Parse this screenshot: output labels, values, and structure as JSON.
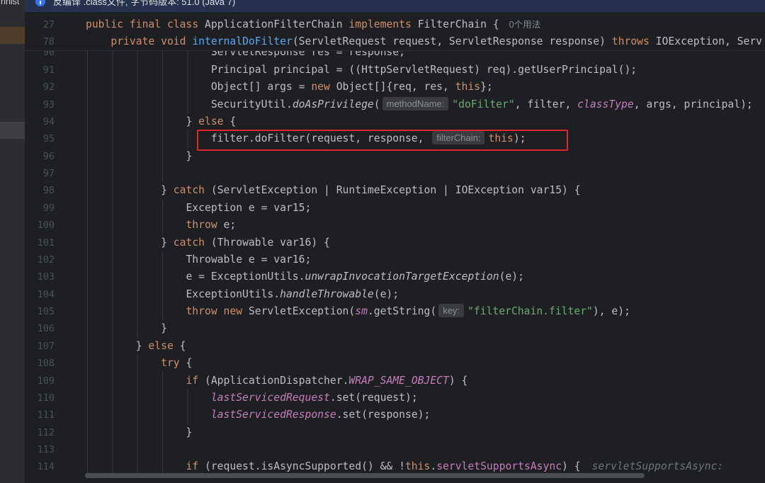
{
  "window": {
    "sidebar_label": "nnist"
  },
  "banner": {
    "icon": "info-icon",
    "text": "反编译 .class文件, 字节码版本: 51.0 (Java 7)"
  },
  "colors": {
    "editor_bg": "#1e1f22",
    "banner": "#25324d",
    "keyword": "#cf8e6d",
    "plain_text": "#bcbec4",
    "method_declaration": "#56a8f5",
    "string": "#6aab73",
    "field": "#c77dbb",
    "line_number": "#4b5059",
    "hint_bg": "#393b40",
    "hint_text": "#8c8f94",
    "highlight_box": "#e0262a"
  },
  "sticky_lines": [
    {
      "number": "27",
      "depth": 0,
      "usages": "0个用法",
      "tokens": [
        {
          "k": "kw",
          "s": "public"
        },
        {
          "k": "plain",
          "s": " "
        },
        {
          "k": "kw",
          "s": "final"
        },
        {
          "k": "plain",
          "s": " "
        },
        {
          "k": "kw",
          "s": "class"
        },
        {
          "k": "plain",
          "s": " ApplicationFilterChain "
        },
        {
          "k": "kw",
          "s": "implements"
        },
        {
          "k": "plain",
          "s": " FilterChain {"
        }
      ]
    },
    {
      "number": "78",
      "depth": 1,
      "tokens": [
        {
          "k": "kw",
          "s": "private"
        },
        {
          "k": "plain",
          "s": " "
        },
        {
          "k": "kw",
          "s": "void"
        },
        {
          "k": "plain",
          "s": " "
        },
        {
          "k": "decl",
          "s": "internalDoFilter"
        },
        {
          "k": "plain",
          "s": "(ServletRequest request, ServletResponse response) "
        },
        {
          "k": "kw",
          "s": "throws"
        },
        {
          "k": "plain",
          "s": " IOException, Serv"
        }
      ]
    }
  ],
  "lines": [
    {
      "number": "90",
      "depth": 5,
      "tokens": [
        {
          "k": "plain",
          "s": "ServletResponse res = response;"
        }
      ]
    },
    {
      "number": "91",
      "depth": 5,
      "tokens": [
        {
          "k": "plain",
          "s": "Principal principal = ((HttpServletRequest) req).getUserPrincipal();"
        }
      ]
    },
    {
      "number": "92",
      "depth": 5,
      "tokens": [
        {
          "k": "plain",
          "s": "Object[] args = "
        },
        {
          "k": "kw",
          "s": "new"
        },
        {
          "k": "plain",
          "s": " Object[]{req, res, "
        },
        {
          "k": "kw",
          "s": "this"
        },
        {
          "k": "plain",
          "s": "};"
        }
      ]
    },
    {
      "number": "93",
      "depth": 5,
      "tokens": [
        {
          "k": "plain",
          "s": "SecurityUtil."
        },
        {
          "k": "smethod",
          "s": "doAsPrivilege"
        },
        {
          "k": "plain",
          "s": "("
        },
        {
          "k": "hint",
          "s": "methodName:"
        },
        {
          "k": "str",
          "s": "\"doFilter\""
        },
        {
          "k": "plain",
          "s": ", filter, "
        },
        {
          "k": "sfield",
          "s": "classType"
        },
        {
          "k": "plain",
          "s": ", args, principal);"
        }
      ]
    },
    {
      "number": "94",
      "depth": 4,
      "tokens": [
        {
          "k": "plain",
          "s": "} "
        },
        {
          "k": "kw",
          "s": "else"
        },
        {
          "k": "plain",
          "s": " {"
        }
      ]
    },
    {
      "number": "95",
      "depth": 5,
      "highlighted": true,
      "tokens": [
        {
          "k": "plain",
          "s": "filter.doFilter(request, response, "
        },
        {
          "k": "hint",
          "s": "filterChain:"
        },
        {
          "k": "kw",
          "s": "this"
        },
        {
          "k": "plain",
          "s": ");"
        }
      ]
    },
    {
      "number": "96",
      "depth": 4,
      "tokens": [
        {
          "k": "plain",
          "s": "}"
        }
      ]
    },
    {
      "number": "97",
      "depth": 4,
      "tokens": []
    },
    {
      "number": "98",
      "depth": 3,
      "tokens": [
        {
          "k": "plain",
          "s": "} "
        },
        {
          "k": "kw",
          "s": "catch"
        },
        {
          "k": "plain",
          "s": " (ServletException | RuntimeException | IOException var15) {"
        }
      ]
    },
    {
      "number": "99",
      "depth": 4,
      "tokens": [
        {
          "k": "plain",
          "s": "Exception e = var15;"
        }
      ]
    },
    {
      "number": "100",
      "depth": 4,
      "tokens": [
        {
          "k": "kw",
          "s": "throw"
        },
        {
          "k": "plain",
          "s": " e;"
        }
      ]
    },
    {
      "number": "101",
      "depth": 3,
      "tokens": [
        {
          "k": "plain",
          "s": "} "
        },
        {
          "k": "kw",
          "s": "catch"
        },
        {
          "k": "plain",
          "s": " (Throwable var16) {"
        }
      ]
    },
    {
      "number": "102",
      "depth": 4,
      "tokens": [
        {
          "k": "plain",
          "s": "Throwable e = var16;"
        }
      ]
    },
    {
      "number": "103",
      "depth": 4,
      "tokens": [
        {
          "k": "plain",
          "s": "e = ExceptionUtils."
        },
        {
          "k": "smethod",
          "s": "unwrapInvocationTargetException"
        },
        {
          "k": "plain",
          "s": "(e);"
        }
      ]
    },
    {
      "number": "104",
      "depth": 4,
      "tokens": [
        {
          "k": "plain",
          "s": "ExceptionUtils."
        },
        {
          "k": "smethod",
          "s": "handleThrowable"
        },
        {
          "k": "plain",
          "s": "(e);"
        }
      ]
    },
    {
      "number": "105",
      "depth": 4,
      "tokens": [
        {
          "k": "kw",
          "s": "throw"
        },
        {
          "k": "plain",
          "s": " "
        },
        {
          "k": "kw",
          "s": "new"
        },
        {
          "k": "plain",
          "s": " ServletException("
        },
        {
          "k": "sfield",
          "s": "sm"
        },
        {
          "k": "plain",
          "s": ".getString("
        },
        {
          "k": "hint",
          "s": "key:"
        },
        {
          "k": "str",
          "s": "\"filterChain.filter\""
        },
        {
          "k": "plain",
          "s": "), e);"
        }
      ]
    },
    {
      "number": "106",
      "depth": 3,
      "tokens": [
        {
          "k": "plain",
          "s": "}"
        }
      ]
    },
    {
      "number": "107",
      "depth": 2,
      "tokens": [
        {
          "k": "plain",
          "s": "} "
        },
        {
          "k": "kw",
          "s": "else"
        },
        {
          "k": "plain",
          "s": " {"
        }
      ]
    },
    {
      "number": "108",
      "depth": 3,
      "tokens": [
        {
          "k": "kw",
          "s": "try"
        },
        {
          "k": "plain",
          "s": " {"
        }
      ]
    },
    {
      "number": "109",
      "depth": 4,
      "tokens": [
        {
          "k": "kw",
          "s": "if"
        },
        {
          "k": "plain",
          "s": " (ApplicationDispatcher."
        },
        {
          "k": "sfield",
          "s": "WRAP_SAME_OBJECT"
        },
        {
          "k": "plain",
          "s": ") {"
        }
      ]
    },
    {
      "number": "110",
      "depth": 5,
      "tokens": [
        {
          "k": "sfield",
          "s": "lastServicedRequest"
        },
        {
          "k": "plain",
          "s": ".set(request);"
        }
      ]
    },
    {
      "number": "111",
      "depth": 5,
      "tokens": [
        {
          "k": "sfield",
          "s": "lastServicedResponse"
        },
        {
          "k": "plain",
          "s": ".set(response);"
        }
      ]
    },
    {
      "number": "112",
      "depth": 4,
      "tokens": [
        {
          "k": "plain",
          "s": "}"
        }
      ]
    },
    {
      "number": "113",
      "depth": 4,
      "tokens": []
    },
    {
      "number": "114",
      "depth": 4,
      "tokens": [
        {
          "k": "kw",
          "s": "if"
        },
        {
          "k": "plain",
          "s": " (request.isAsyncSupported() && !"
        },
        {
          "k": "kw",
          "s": "this"
        },
        {
          "k": "plain",
          "s": "."
        },
        {
          "k": "field",
          "s": "servletSupportsAsync"
        },
        {
          "k": "plain",
          "s": ") {"
        },
        {
          "k": "inline",
          "s": "servletSupportsAsync:"
        }
      ]
    }
  ]
}
